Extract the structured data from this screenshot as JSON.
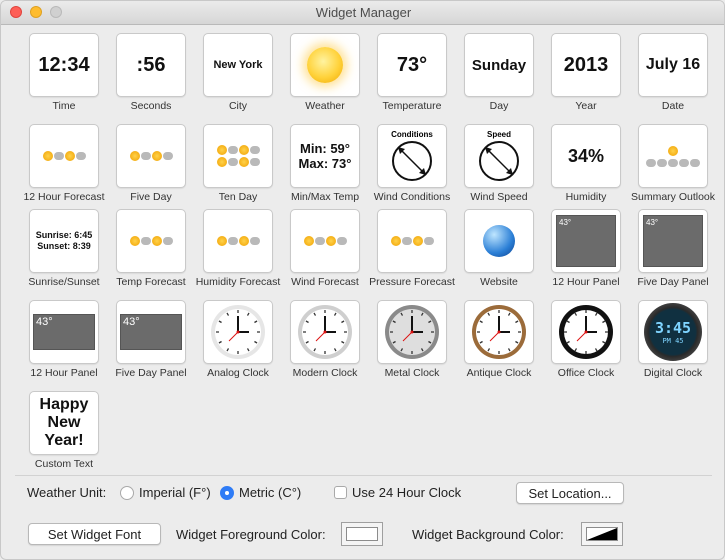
{
  "window": {
    "title": "Widget Manager"
  },
  "widgets": [
    {
      "label": "Time",
      "display": "12:34",
      "kind": "text",
      "size": 20
    },
    {
      "label": "Seconds",
      "display": ":56",
      "kind": "text",
      "size": 20
    },
    {
      "label": "City",
      "display": "New York",
      "kind": "text",
      "size": 11
    },
    {
      "label": "Weather",
      "display": "",
      "kind": "sun"
    },
    {
      "label": "Temperature",
      "display": "73°",
      "kind": "text",
      "size": 20
    },
    {
      "label": "Day",
      "display": "Sunday",
      "kind": "text",
      "size": 15
    },
    {
      "label": "Year",
      "display": "2013",
      "kind": "text",
      "size": 20
    },
    {
      "label": "Date",
      "display": "July 16",
      "kind": "text",
      "size": 16
    },
    {
      "label": "12 Hour Forecast",
      "display": "",
      "kind": "forecast"
    },
    {
      "label": "Five Day",
      "display": "",
      "kind": "forecast"
    },
    {
      "label": "Ten Day",
      "display": "",
      "kind": "forecast2"
    },
    {
      "label": "Min/Max Temp",
      "display": "Min: 59°\nMax: 73°",
      "kind": "multiline",
      "size": 13
    },
    {
      "label": "Wind Conditions",
      "display": "Conditions",
      "kind": "dial"
    },
    {
      "label": "Wind Speed",
      "display": "Speed",
      "kind": "dial"
    },
    {
      "label": "Humidity",
      "display": "34%",
      "kind": "text",
      "size": 18
    },
    {
      "label": "Summary Outlook",
      "display": "",
      "kind": "summary"
    },
    {
      "label": "Sunrise/Sunset",
      "display": "Sunrise: 6:45\nSunset: 8:39",
      "kind": "multiline",
      "size": 9
    },
    {
      "label": "Temp Forecast",
      "display": "",
      "kind": "forecast"
    },
    {
      "label": "Humidity Forecast",
      "display": "",
      "kind": "forecast"
    },
    {
      "label": "Wind Forecast",
      "display": "",
      "kind": "forecast"
    },
    {
      "label": "Pressure Forecast",
      "display": "",
      "kind": "forecast"
    },
    {
      "label": "Website",
      "display": "",
      "kind": "globe"
    },
    {
      "label": "12 Hour Panel",
      "display": "43°",
      "kind": "panel"
    },
    {
      "label": "Five Day Panel",
      "display": "43°",
      "kind": "panel"
    },
    {
      "label": "12 Hour Panel",
      "display": "43°",
      "kind": "panelwide"
    },
    {
      "label": "Five Day Panel",
      "display": "43°",
      "kind": "panelwide"
    },
    {
      "label": "Analog Clock",
      "display": "",
      "kind": "clock",
      "style": "white"
    },
    {
      "label": "Modern Clock",
      "display": "",
      "kind": "clock",
      "style": "modern"
    },
    {
      "label": "Metal Clock",
      "display": "",
      "kind": "clock",
      "style": "metal"
    },
    {
      "label": "Antique Clock",
      "display": "",
      "kind": "clock",
      "style": "antique"
    },
    {
      "label": "Office Clock",
      "display": "",
      "kind": "clock",
      "style": "office"
    },
    {
      "label": "Digital Clock",
      "display": "3:45",
      "kind": "digital",
      "sub": "PM 45"
    },
    {
      "label": "Custom Text",
      "display": "Happy\nNew\nYear!",
      "kind": "multiline",
      "size": 16
    }
  ],
  "settings": {
    "weather_unit_label": "Weather Unit:",
    "imperial_label": "Imperial (F°)",
    "metric_label": "Metric (C°)",
    "selected_unit": "metric",
    "clock24_label": "Use 24 Hour Clock",
    "clock24_checked": false,
    "set_location_label": "Set Location...",
    "set_font_label": "Set Widget Font",
    "fg_color_label": "Widget Foreground Color:",
    "bg_color_label": "Widget Background Color:",
    "fg_color": "#ffffff",
    "bg_color": "#000000"
  }
}
